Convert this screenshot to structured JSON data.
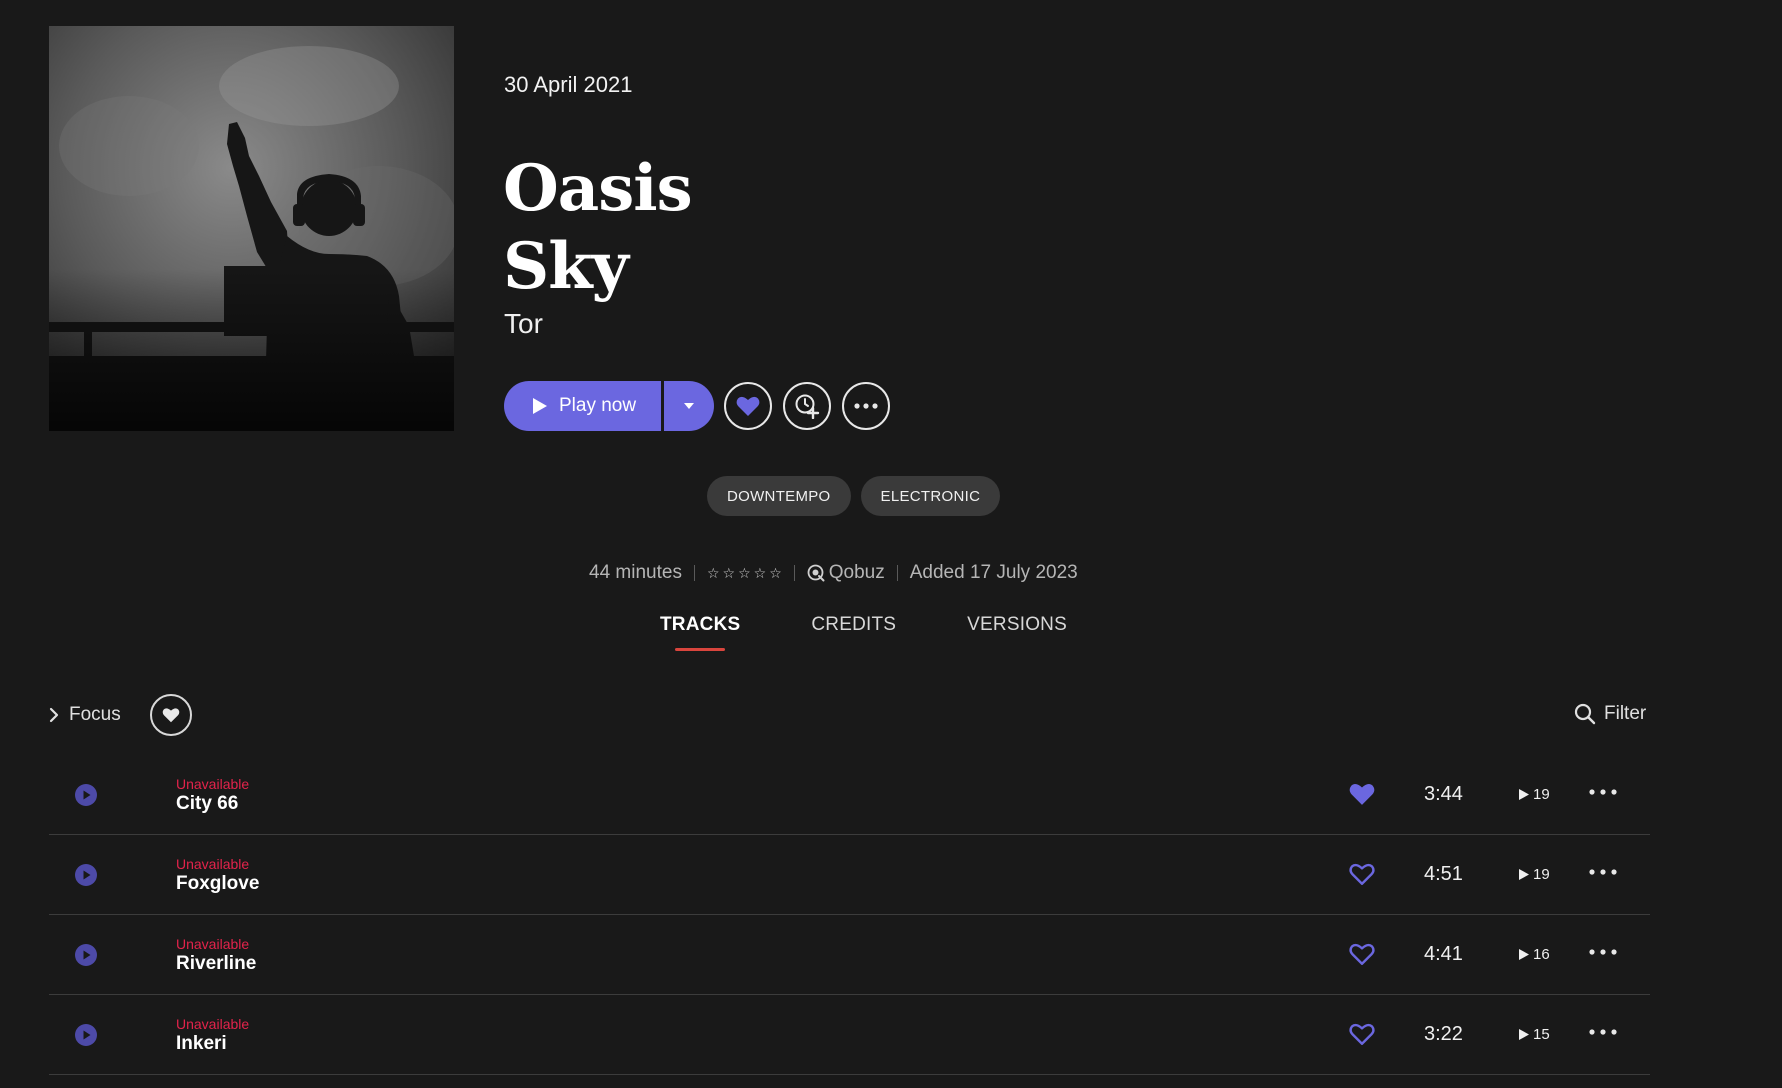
{
  "album": {
    "release_date": "30 April 2021",
    "title_line1": "Oasis",
    "title_line2": "Sky",
    "artist": "Tor",
    "cover_icon": "album-cover-dj-silhouette"
  },
  "actions": {
    "play_label": "Play now",
    "play_icon": "play-icon",
    "dropdown_icon": "caret-down-icon",
    "favorite_icon": "heart-icon",
    "queue_icon": "clock-plus-icon",
    "more_icon": "ellipsis-icon"
  },
  "tags": [
    "DOWNTEMPO",
    "ELECTRONIC"
  ],
  "meta": {
    "duration": "44 minutes",
    "rating_stars": 0,
    "source": "Qobuz",
    "added": "Added 17 July 2023"
  },
  "tabs": [
    {
      "label": "TRACKS",
      "active": true
    },
    {
      "label": "CREDITS",
      "active": false
    },
    {
      "label": "VERSIONS",
      "active": false
    }
  ],
  "toolbar": {
    "focus_label": "Focus",
    "filter_label": "Filter"
  },
  "tracks": [
    {
      "status": "Unavailable",
      "name": "City 66",
      "favorited": true,
      "duration": "3:44",
      "plays": "19"
    },
    {
      "status": "Unavailable",
      "name": "Foxglove",
      "favorited": false,
      "duration": "4:51",
      "plays": "19"
    },
    {
      "status": "Unavailable",
      "name": "Riverline",
      "favorited": false,
      "duration": "4:41",
      "plays": "16"
    },
    {
      "status": "Unavailable",
      "name": "Inkeri",
      "favorited": false,
      "duration": "3:22",
      "plays": "15"
    }
  ],
  "colors": {
    "background": "#191919",
    "accent": "#6b67e0",
    "unavailable": "#e2234b",
    "tab_underline": "#d9453d",
    "tag_bg": "#3a3a3a"
  }
}
